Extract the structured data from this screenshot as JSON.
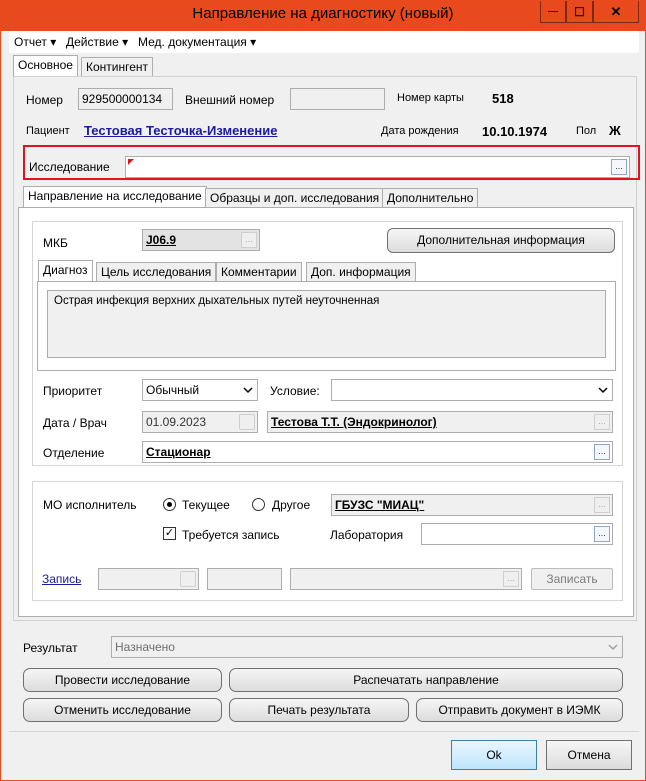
{
  "window": {
    "title": "Направление на диагностику (новый)",
    "controls": {
      "minimize": "—",
      "maximize": "☐",
      "close": "✕"
    }
  },
  "menu": [
    {
      "label": "Отчет ▾"
    },
    {
      "label": "Действие ▾"
    },
    {
      "label": "Мед. документация ▾"
    }
  ],
  "top_tabs": [
    {
      "label": "Основное",
      "active": true
    },
    {
      "label": "Контингент",
      "active": false
    }
  ],
  "header": {
    "number_label": "Номер",
    "number_value": "929500000134",
    "external_number_label": "Внешний номер",
    "external_number_value": "",
    "card_number_label": "Номер карты",
    "card_number_value": "518",
    "patient_label": "Пациент",
    "patient_value": "Тестовая Тесточка-Изменение",
    "birth_label": "Дата рождения",
    "birth_value": "10.10.1974",
    "sex_label": "Пол",
    "sex_value": "Ж"
  },
  "study": {
    "label": "Исследование",
    "value": "",
    "dots": "..."
  },
  "inner_tabs": [
    {
      "label": "Направление на исследование",
      "active": true
    },
    {
      "label": "Образцы и доп. исследования",
      "active": false
    },
    {
      "label": "Дополнительно",
      "active": false
    }
  ],
  "referral": {
    "mkb_label": "МКБ",
    "mkb_value": "J06.9",
    "additional_info_button": "Дополнительная информация",
    "diag_tabs": [
      {
        "label": "Диагноз",
        "active": true
      },
      {
        "label": "Цель исследования",
        "active": false
      },
      {
        "label": "Комментарии",
        "active": false
      },
      {
        "label": "Доп. информация",
        "active": false
      }
    ],
    "diagnosis_text": "Острая инфекция верхних дыхательных путей неуточненная",
    "priority_label": "Приоритет",
    "priority_value": "Обычный",
    "condition_label": "Условие:",
    "condition_value": "",
    "date_doctor_label": "Дата / Врач",
    "date_value": "01.09.2023",
    "doctor_value": "Тестова Т.Т. (Эндокринолог)",
    "department_label": "Отделение",
    "department_value": "Стационар"
  },
  "executor": {
    "mo_label": "МО исполнитель",
    "current_label": "Текущее",
    "other_label": "Другое",
    "mo_value": "ГБУЗС \"МИАЦ\"",
    "current_selected": true,
    "requires_booking_label": "Требуется запись",
    "requires_booking_checked": true,
    "lab_label": "Лаборатория",
    "lab_value": "",
    "booking_link": "Запись",
    "booking_button": "Записать"
  },
  "result": {
    "label": "Результат",
    "value": "Назначено"
  },
  "actions": {
    "conduct": "Провести исследование",
    "print_referral": "Распечатать направление",
    "cancel_study": "Отменить исследование",
    "print_result": "Печать результата",
    "send_iemk": "Отправить документ в ИЭМК"
  },
  "footer": {
    "ok": "Ok",
    "cancel": "Отмена"
  },
  "colors": {
    "titlebar": "#e84a1e",
    "highlight_border": "#e0141e",
    "link": "#1a1a9c"
  }
}
